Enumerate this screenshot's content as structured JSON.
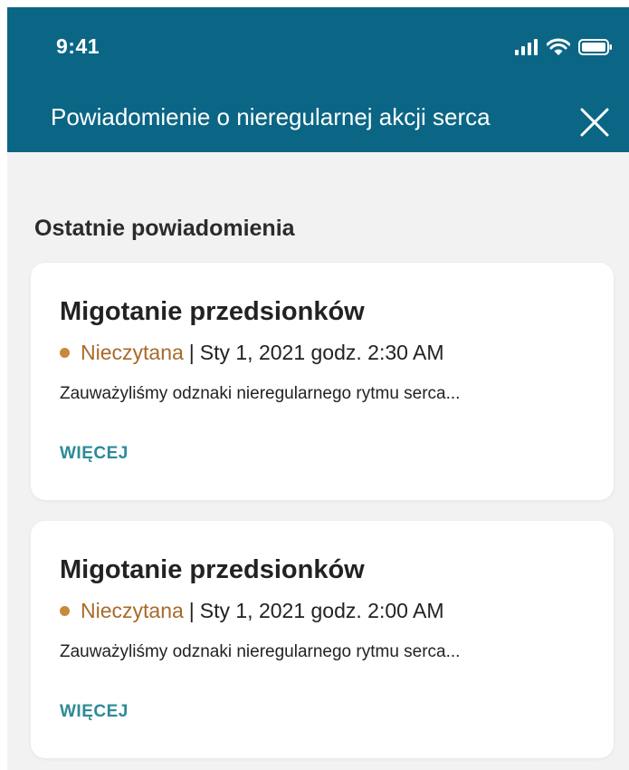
{
  "status_bar": {
    "time": "9:41",
    "icons": [
      "signal-icon",
      "wifi-icon",
      "battery-icon"
    ]
  },
  "header": {
    "title": "Powiadomienie o nieregularnej akcji serca",
    "close_icon": "close-icon"
  },
  "section": {
    "title": "Ostatnie powiadomienia"
  },
  "notifications": [
    {
      "title": "Migotanie przedsionków",
      "status": "Nieczytana",
      "separator": "|",
      "datetime": "Sty 1, 2021 godz. 2:30 AM",
      "description": "Zauważyliśmy odznaki nieregularnego rytmu serca...",
      "more_label": "WIĘCEJ"
    },
    {
      "title": "Migotanie przedsionków",
      "status": "Nieczytana",
      "separator": "|",
      "datetime": "Sty 1, 2021 godz. 2:00 AM",
      "description": "Zauważyliśmy odznaki nieregularnego rytmu serca...",
      "more_label": "WIĘCEJ"
    }
  ],
  "colors": {
    "header_bg": "#0b6685",
    "content_bg": "#f2f2f2",
    "unread": "#a86a2a",
    "unread_dot": "#c88a3a",
    "link": "#2c8a97"
  }
}
